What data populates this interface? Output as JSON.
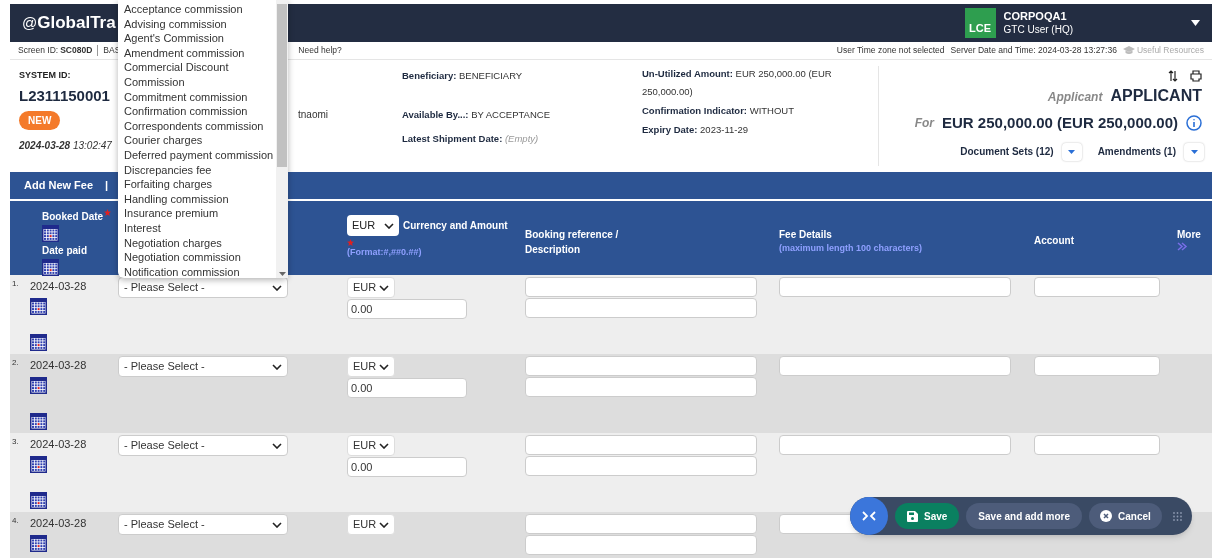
{
  "header": {
    "logo_prefix": "@",
    "logo_text": "GlobalTra",
    "user_badge": "LCE",
    "user_name": "CORPOQA1",
    "user_role": "GTC User (HQ)"
  },
  "subheader": {
    "screen_id_label": "Screen ID:",
    "screen_id": "SC080D",
    "crumb": "BAS",
    "help": "Need help?",
    "timezone": "User Time zone not selected",
    "server_time": "Server Date and Time: 2024-03-28 13:27:36",
    "resources": "Useful Resources"
  },
  "summary": {
    "system_id_label": "SYSTEM ID:",
    "system_id": "L2311150001",
    "status": "NEW",
    "date": "2024-03-28",
    "time": "13:02:47",
    "user_fragment": "tnaomi",
    "fields_left": [
      {
        "label": "Beneficiary:",
        "value": "BENEFICIARY",
        "muted": false
      },
      {
        "label": "Available By...:",
        "value": "BY ACCEPTANCE",
        "muted": false
      },
      {
        "label": "Latest Shipment Date:",
        "value": "(Empty)",
        "muted": true
      }
    ],
    "fields_right": [
      {
        "label": "Un-Utilized Amount:",
        "value": "EUR 250,000.00 (EUR 250,000.00)",
        "muted": false
      },
      {
        "label": "Confirmation Indicator:",
        "value": "WITHOUT",
        "muted": false
      },
      {
        "label": "Expiry Date:",
        "value": "2023-11-29",
        "muted": false
      }
    ],
    "applicant_label": "Applicant",
    "applicant": "APPLICANT",
    "for_label": "For",
    "amount": "EUR 250,000.00 (EUR 250,000.00)",
    "links": [
      {
        "label": "Document Sets (12)"
      },
      {
        "label": "Amendments (1)"
      }
    ]
  },
  "toolbar": {
    "action": "Add New Fee",
    "separator": "|"
  },
  "table": {
    "columns": {
      "booked_date": "Booked Date",
      "date_paid": "Date paid",
      "currency": "EUR",
      "currency_amount": "Currency and Amount",
      "format_hint": "(Format:#,##0.##)",
      "booking_ref": "Booking reference / Description",
      "fee_details": "Fee Details",
      "fee_hint": "(maximum length 100 characters)",
      "account": "Account",
      "more": "More"
    },
    "rows": [
      {
        "number": "1.",
        "date": "2024-03-28",
        "fee_type": "- Please Select -",
        "currency": "EUR",
        "amount": "0.00"
      },
      {
        "number": "2.",
        "date": "2024-03-28",
        "fee_type": "- Please Select -",
        "currency": "EUR",
        "amount": "0.00"
      },
      {
        "number": "3.",
        "date": "2024-03-28",
        "fee_type": "- Please Select -",
        "currency": "EUR",
        "amount": "0.00"
      },
      {
        "number": "4.",
        "date": "2024-03-28",
        "fee_type": "- Please Select -",
        "currency": "EUR"
      }
    ]
  },
  "fee_type_dropdown": {
    "options": [
      "Acceptance commission",
      "Advising commission",
      "Agent's Commission",
      "Amendment commission",
      "Commercial Discount Commission",
      "Commitment commission",
      "Confirmation commission",
      "Correspondents commission",
      "Courier charges",
      "Deferred payment commission",
      "Discrepancies fee",
      "Forfaiting charges",
      "Handling commission",
      "Insurance premium",
      "Interest",
      "Negotiation charges",
      "Negotiation commission",
      "Notification commission"
    ]
  },
  "action_bar": {
    "save": "Save",
    "save_more": "Save and add more",
    "cancel": "Cancel"
  }
}
